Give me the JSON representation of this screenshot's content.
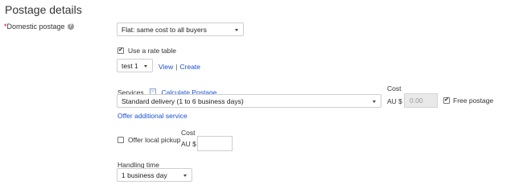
{
  "page_title": "Postage details",
  "domestic": {
    "required_marker": "*",
    "label": "Domestic postage",
    "info_icon": "?",
    "postage_type": "Flat: same cost to all buyers"
  },
  "rate_table": {
    "checked": true,
    "label": "Use a rate table",
    "selected": "test 1",
    "view_link": "View",
    "separator": "|",
    "create_link": "Create"
  },
  "services": {
    "label": "Services",
    "calc_link": "Calculate Postage",
    "cost_header": "Cost",
    "service_selected": "Standard delivery (1 to 6 business days)",
    "currency": "AU $",
    "cost_value": "0.00",
    "free_postage_checked": true,
    "free_postage_label": "Free postage",
    "offer_additional": "Offer additional service"
  },
  "local_pickup": {
    "checked": false,
    "label": "Offer local pickup",
    "cost_header": "Cost",
    "currency": "AU $",
    "cost_value": ""
  },
  "handling": {
    "label": "Handling time",
    "selected": "1 business day"
  },
  "colors": {
    "link": "#1a4fd6",
    "required": "#cc0000",
    "disabled_bg": "#e9e9e9"
  }
}
